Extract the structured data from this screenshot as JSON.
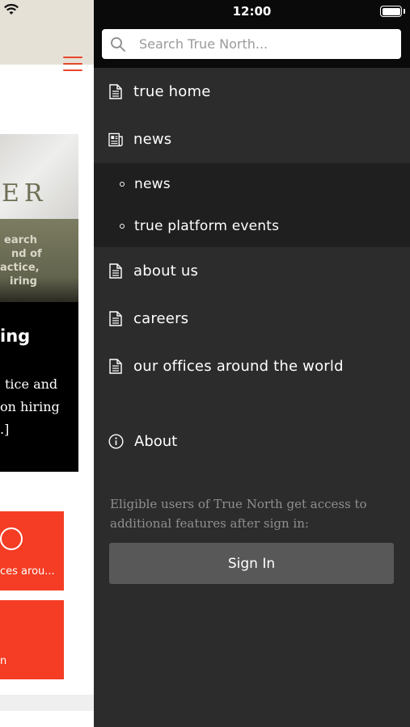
{
  "status_bar": {
    "time": "12:00"
  },
  "search": {
    "placeholder": "Search True North..."
  },
  "nav": {
    "items": [
      {
        "label": "true home",
        "icon": "document-icon"
      },
      {
        "label": "news",
        "icon": "newspaper-icon"
      },
      {
        "label": "about us",
        "icon": "document-icon"
      },
      {
        "label": "careers",
        "icon": "document-icon"
      },
      {
        "label": "our offices around the world",
        "icon": "document-icon"
      }
    ],
    "sub_items": [
      {
        "label": "news"
      },
      {
        "label": "true platform events"
      }
    ]
  },
  "about": {
    "label": "About",
    "icon": "info-icon"
  },
  "sign_in": {
    "note": "Eligible users of True North get access to additional features after sign in:",
    "button": "Sign In"
  },
  "background": {
    "hero_logo": "ER",
    "hero_band_lines": [
      "earch",
      "nd of",
      "actice,",
      "iring"
    ],
    "hero_title": "ing",
    "hero_body_lines": [
      "tice and",
      "on hiring",
      ".]"
    ],
    "card_1_text": "ces arou...",
    "card_2_text": "n"
  },
  "colors": {
    "accent": "#f43d24",
    "drawer_bg": "#2c2c2c",
    "submenu_bg": "#1f1f1f",
    "button_bg": "#585858"
  }
}
